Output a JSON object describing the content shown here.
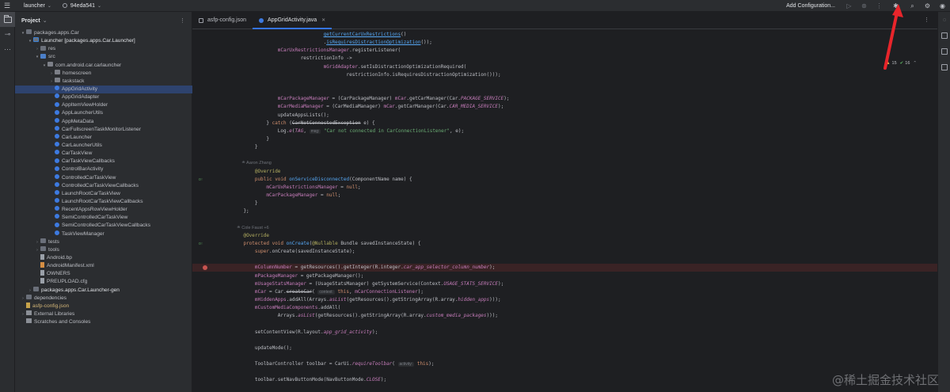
{
  "topbar": {
    "project_name": "launcher",
    "branch": "94eda541",
    "add_config": "Add Configuration..."
  },
  "panel": {
    "title": "Project",
    "tree": [
      {
        "label": "packages.apps.Car",
        "depth": 0,
        "arrow": "▾",
        "icon": "folder",
        "style": ""
      },
      {
        "label": "Launcher [packages.apps.Car.Launcher]",
        "depth": 1,
        "arrow": "▾",
        "icon": "folder mod",
        "style": "bold"
      },
      {
        "label": "res",
        "depth": 2,
        "arrow": "›",
        "icon": "folder",
        "style": ""
      },
      {
        "label": "src",
        "depth": 2,
        "arrow": "▾",
        "icon": "folder src",
        "style": ""
      },
      {
        "label": "com.android.car.carlauncher",
        "depth": 3,
        "arrow": "▾",
        "icon": "pkg",
        "style": ""
      },
      {
        "label": "homescreen",
        "depth": 4,
        "arrow": "›",
        "icon": "pkg",
        "style": ""
      },
      {
        "label": "taskstack",
        "depth": 4,
        "arrow": "›",
        "icon": "pkg",
        "style": ""
      },
      {
        "label": "AppGridActivity",
        "depth": 4,
        "arrow": "",
        "icon": "cls",
        "style": "",
        "selected": true
      },
      {
        "label": "AppGridAdapter",
        "depth": 4,
        "arrow": "",
        "icon": "cls",
        "style": ""
      },
      {
        "label": "AppItemViewHolder",
        "depth": 4,
        "arrow": "",
        "icon": "cls",
        "style": ""
      },
      {
        "label": "AppLauncherUtils",
        "depth": 4,
        "arrow": "",
        "icon": "cls",
        "style": ""
      },
      {
        "label": "AppMetaData",
        "depth": 4,
        "arrow": "",
        "icon": "cls",
        "style": ""
      },
      {
        "label": "CarFullscreenTaskMonitorListener",
        "depth": 4,
        "arrow": "",
        "icon": "cls",
        "style": ""
      },
      {
        "label": "CarLauncher",
        "depth": 4,
        "arrow": "",
        "icon": "cls",
        "style": ""
      },
      {
        "label": "CarLauncherUtils",
        "depth": 4,
        "arrow": "",
        "icon": "cls",
        "style": ""
      },
      {
        "label": "CarTaskView",
        "depth": 4,
        "arrow": "",
        "icon": "cls",
        "style": ""
      },
      {
        "label": "CarTaskViewCallbacks",
        "depth": 4,
        "arrow": "",
        "icon": "cls",
        "style": ""
      },
      {
        "label": "ControlBarActivity",
        "depth": 4,
        "arrow": "",
        "icon": "cls",
        "style": ""
      },
      {
        "label": "ControlledCarTaskView",
        "depth": 4,
        "arrow": "",
        "icon": "cls",
        "style": ""
      },
      {
        "label": "ControlledCarTaskViewCallbacks",
        "depth": 4,
        "arrow": "",
        "icon": "cls",
        "style": ""
      },
      {
        "label": "LaunchRootCarTaskView",
        "depth": 4,
        "arrow": "",
        "icon": "cls",
        "style": ""
      },
      {
        "label": "LaunchRootCarTaskViewCallbacks",
        "depth": 4,
        "arrow": "",
        "icon": "cls",
        "style": ""
      },
      {
        "label": "RecentAppsRowViewHolder",
        "depth": 4,
        "arrow": "",
        "icon": "cls",
        "style": ""
      },
      {
        "label": "SemiControlledCarTaskView",
        "depth": 4,
        "arrow": "",
        "icon": "cls",
        "style": ""
      },
      {
        "label": "SemiControlledCarTaskViewCallbacks",
        "depth": 4,
        "arrow": "",
        "icon": "cls",
        "style": ""
      },
      {
        "label": "TaskViewManager",
        "depth": 4,
        "arrow": "",
        "icon": "cls",
        "style": ""
      },
      {
        "label": "tests",
        "depth": 2,
        "arrow": "›",
        "icon": "folder",
        "style": ""
      },
      {
        "label": "tools",
        "depth": 2,
        "arrow": "›",
        "icon": "folder",
        "style": ""
      },
      {
        "label": "Android.bp",
        "depth": 2,
        "arrow": "",
        "icon": "file",
        "style": ""
      },
      {
        "label": "AndroidManifest.xml",
        "depth": 2,
        "arrow": "",
        "icon": "file xml",
        "style": ""
      },
      {
        "label": "OWNERS",
        "depth": 2,
        "arrow": "",
        "icon": "file",
        "style": ""
      },
      {
        "label": "PREUPLOAD.cfg",
        "depth": 2,
        "arrow": "",
        "icon": "file",
        "style": ""
      },
      {
        "label": "packages.apps.Car.Launcher-gen",
        "depth": 1,
        "arrow": "›",
        "icon": "folder",
        "style": "bold"
      },
      {
        "label": "dependencies",
        "depth": 0,
        "arrow": "›",
        "icon": "folder",
        "style": ""
      },
      {
        "label": "asfp-config.json",
        "depth": 0,
        "arrow": "",
        "icon": "file json",
        "style": "orange"
      },
      {
        "label": "External Libraries",
        "depth": 0,
        "arrow": "›",
        "icon": "lib",
        "style": ""
      },
      {
        "label": "Scratches and Consoles",
        "depth": 0,
        "arrow": "",
        "icon": "lib",
        "style": ""
      }
    ]
  },
  "tabs": [
    {
      "label": "asfp-config.json",
      "icon": "json",
      "active": false
    },
    {
      "label": "AppGridActivity.java",
      "icon": "cls",
      "active": true
    }
  ],
  "inspection": {
    "warnings": "15",
    "ok": "16"
  },
  "editor": {
    "lines": [
      {
        "ln": "",
        "html": "                                <span class='mth ul'>getCurrentCarUxRestrictions</span>()"
      },
      {
        "ln": "",
        "html": "                                .<span class='mth ul'>isRequiresDistractionOptimization</span>());"
      },
      {
        "ln": "",
        "html": "                <span class='fld'>mCarUxRestrictionsManager</span>.registerListener("
      },
      {
        "ln": "",
        "html": "                        restrictionInfo ->"
      },
      {
        "ln": "",
        "html": "                                <span class='fld'>mGridAdapter</span>.setIsDistractionOptimizationRequired("
      },
      {
        "ln": "",
        "html": "                                        restrictionInfo.isRequiresDistractionOptimization()));"
      },
      {
        "ln": "",
        "html": ""
      },
      {
        "ln": "",
        "html": ""
      },
      {
        "ln": "",
        "html": "                <span class='fld'>mCarPackageManager</span> = (CarPackageManager) <span class='fld'>mCar</span>.getCarManager(Car.<span class='cst'>PACKAGE_SERVICE</span>);"
      },
      {
        "ln": "",
        "html": "                <span class='fld'>mCarMediaManager</span> = (CarMediaManager) <span class='fld'>mCar</span>.getCarManager(Car.<span class='cst'>CAR_MEDIA_SERVICE</span>);"
      },
      {
        "ln": "",
        "html": "                updateAppsLists();"
      },
      {
        "ln": "",
        "html": "            } <span class='kw'>catch</span> (<span class='strike'>CarNotConnectedException</span> e) {"
      },
      {
        "ln": "",
        "html": "                Log.<span class='cst'>e</span>(<span class='cst'>TAG</span>, <span class='param'>msg:</span> <span class='str'>\"Car not connected in CarConnectionListener\"</span>, e);"
      },
      {
        "ln": "",
        "html": "            }"
      },
      {
        "ln": "",
        "html": "        }"
      },
      {
        "ln": "",
        "html": ""
      },
      {
        "ln": "",
        "hint": true,
        "html": "        ≗ Aaron Zhang"
      },
      {
        "ln": "",
        "html": "        <span class='ann'>@Override</span>"
      },
      {
        "ln": "",
        "gutter": "ov",
        "html": "        <span class='kw'>public void</span> <span class='mth'>onServiceDisconnected</span>(ComponentName name) {"
      },
      {
        "ln": "",
        "html": "            <span class='fld'>mCarUxRestrictionsManager</span> = <span class='kw'>null</span>;"
      },
      {
        "ln": "",
        "html": "            <span class='fld'>mCarPackageManager</span> = <span class='kw'>null</span>;"
      },
      {
        "ln": "",
        "html": "        }"
      },
      {
        "ln": "",
        "html": "    };"
      },
      {
        "ln": "",
        "html": ""
      },
      {
        "ln": "",
        "hint": true,
        "html": "    ≗ Cole Faust +6"
      },
      {
        "ln": "",
        "html": "    <span class='ann'>@Override</span>"
      },
      {
        "ln": "",
        "gutter": "ov",
        "html": "    <span class='kw'>protected void</span> <span class='mth'>onCreate</span>(<span class='ann'>@Nullable</span> Bundle savedInstanceState) {"
      },
      {
        "ln": "",
        "html": "        <span class='kw'>super</span>.onCreate(savedInstanceState);"
      },
      {
        "ln": "",
        "html": ""
      },
      {
        "ln": "",
        "gutter": "bp",
        "hl": true,
        "html": "        <span class='fld'>mColumnNumber</span> = getResources().getInteger(R.integer.<span class='cst'>car_app_selector_column_number</span>);"
      },
      {
        "ln": "",
        "html": "        <span class='fld'>mPackageManager</span> = getPackageManager();"
      },
      {
        "ln": "",
        "html": "        <span class='fld'>mUsageStatsManager</span> = (UsageStatsManager) getSystemService(Context.<span class='cst'>USAGE_STATS_SERVICE</span>);"
      },
      {
        "ln": "",
        "html": "        <span class='fld'>mCar</span> = Car.<span class='strike'>createCar</span>( <span class='param'>context:</span> <span class='kw'>this</span>, <span class='fld'>mCarConnectionListener</span>);"
      },
      {
        "ln": "",
        "html": "        <span class='fld'>mHiddenApps</span>.addAll(Arrays.<span class='cst'>asList</span>(getResources().getStringArray(R.array.<span class='cst'>hidden_apps</span>)));"
      },
      {
        "ln": "",
        "html": "        <span class='fld'>mCustomMediaComponents</span>.addAll("
      },
      {
        "ln": "",
        "html": "                Arrays.<span class='cst'>asList</span>(getResources().getStringArray(R.array.<span class='cst'>custom_media_packages</span>)));"
      },
      {
        "ln": "",
        "html": ""
      },
      {
        "ln": "",
        "html": "        setContentView(R.layout.<span class='cst'>app_grid_activity</span>);"
      },
      {
        "ln": "",
        "html": ""
      },
      {
        "ln": "",
        "html": "        updateMode();"
      },
      {
        "ln": "",
        "html": ""
      },
      {
        "ln": "",
        "html": "        ToolbarController toolbar = CarUi.<span class='cst'>requireToolbar</span>( <span class='param'>activity:</span> <span class='kw'>this</span>);"
      },
      {
        "ln": "",
        "html": ""
      },
      {
        "ln": "",
        "html": "        toolbar.setNavButtonMode(NavButtonMode.<span class='cst'>CLOSE</span>);"
      }
    ]
  },
  "watermark": "@稀土掘金技术社区"
}
